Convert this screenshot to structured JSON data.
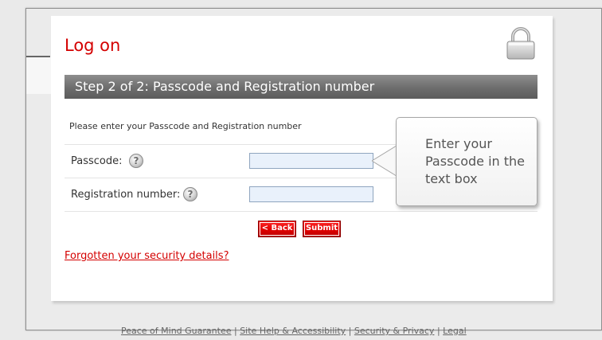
{
  "page": {
    "title": "Log on",
    "step_heading": "Step 2 of 2: Passcode and Registration number",
    "instructions": "Please enter your Passcode and Registration number"
  },
  "form": {
    "passcode_label": "Passcode:",
    "registration_label": "Registration number:",
    "help_glyph": "?",
    "back_label": "< Back",
    "submit_label": "Submit",
    "passcode_value": "",
    "registration_value": ""
  },
  "forgotten_link": "Forgotten your security details?",
  "tooltip": {
    "text": "Enter your Passcode in the text box"
  },
  "footer": {
    "links": [
      "Peace of Mind Guarantee",
      "Site Help & Accessibility",
      "Security & Privacy",
      "Legal"
    ],
    "separator": "|"
  },
  "icons": {
    "lock": "lock-icon",
    "help": "help-icon"
  },
  "colors": {
    "brand_red": "#d40000",
    "step_bar": "#6d6d6d",
    "input_bg": "#e9f1fb"
  }
}
